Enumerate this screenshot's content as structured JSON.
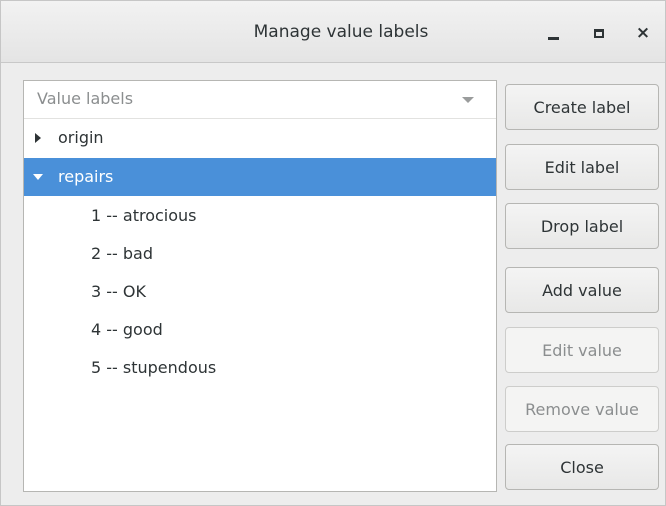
{
  "window": {
    "title": "Manage value labels",
    "controls": {
      "minimize_icon": "minimize-icon",
      "maximize_icon": "maximize-icon",
      "close_icon": "close-icon",
      "close_glyph": "×"
    }
  },
  "tree": {
    "header": "Value labels",
    "header_icon": "chevron-down-icon",
    "items": [
      {
        "label": "origin",
        "expanded": false,
        "selected": false
      },
      {
        "label": "repairs",
        "expanded": true,
        "selected": true,
        "children": [
          "1 -- atrocious",
          "2 -- bad",
          "3 -- OK",
          "4 -- good",
          "5 -- stupendous"
        ]
      }
    ]
  },
  "buttons": {
    "create_label": "Create label",
    "edit_label": "Edit label",
    "drop_label": "Drop label",
    "add_value": "Add value",
    "edit_value": "Edit value",
    "remove_value": "Remove value",
    "close": "Close",
    "disabled": [
      "edit_value",
      "remove_value"
    ]
  },
  "colors": {
    "selection": "#4a90d9",
    "window_bg": "#ededed",
    "text": "#2e3436",
    "disabled_text": "#8b8e8f"
  }
}
